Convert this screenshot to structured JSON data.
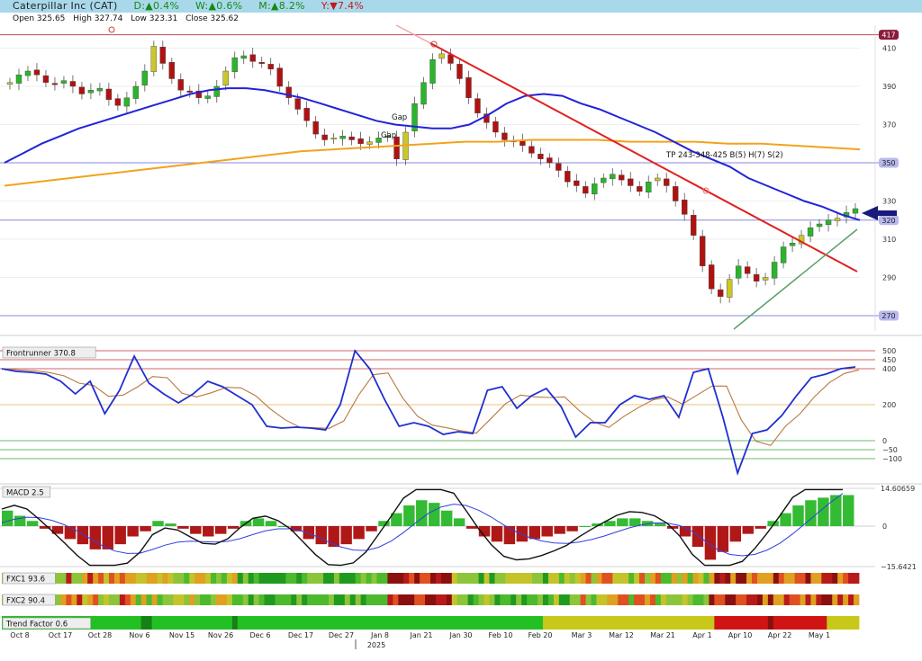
{
  "header": {
    "company": "Caterpillar Inc (CAT)",
    "day_change": "D:▲0.4%",
    "week_change": "W:▲0.6%",
    "month_change": "M:▲8.2%",
    "year_change": "Y:▼7.4%"
  },
  "ohlc": {
    "open": "Open 325.65",
    "high": "High 327.74",
    "low": "Low 323.31",
    "close": "Close 325.62"
  },
  "colors": {
    "header_bg": "#a9d8ea",
    "candle_up": "#2bb52b",
    "candle_down": "#b01212",
    "ma_fast": "#2323d8",
    "ma_slow": "#f2a31b",
    "trend_resistance": "#e02020",
    "trend_support": "#5aa06a"
  },
  "chart_data": [
    {
      "type": "candlestick",
      "ylim": [
        262,
        422
      ],
      "price_axis_labels": [
        410,
        390,
        370,
        350,
        330,
        320,
        310,
        290,
        270
      ],
      "highlighted_levels": [
        "417",
        "350",
        "320",
        "270"
      ],
      "level_lines": [
        417,
        350,
        320,
        270
      ],
      "x_ticks": [
        "Oct 8",
        "Oct 17",
        "Oct 28",
        "Nov 6",
        "Nov 15",
        "Nov 26",
        "Dec 6",
        "Dec 17",
        "Dec 27",
        "Jan 8",
        "Jan 21",
        "Jan 30",
        "Feb 10",
        "Feb 20",
        "Mar 3",
        "Mar 12",
        "Mar 21",
        "Apr 1",
        "Apr 10",
        "Apr 22",
        "May 1"
      ],
      "year_label": "2025",
      "closes": [
        392,
        396,
        398,
        396,
        392,
        391,
        393,
        390,
        386,
        388,
        389,
        383,
        380,
        384,
        390,
        398,
        411,
        402,
        394,
        388,
        387,
        384,
        385,
        390,
        398,
        405,
        406,
        403,
        402,
        399,
        390,
        384,
        378,
        372,
        365,
        362,
        363,
        364,
        362,
        360,
        361,
        363,
        364,
        352,
        366,
        381,
        392,
        404,
        407,
        402,
        394,
        384,
        376,
        371,
        366,
        362,
        361,
        359,
        355,
        352,
        350,
        346,
        340,
        338,
        334,
        339,
        342,
        344,
        341,
        338,
        335,
        340,
        342,
        338,
        330,
        323,
        312,
        296,
        284,
        280,
        289,
        296,
        292,
        288,
        290,
        298,
        306,
        308,
        312,
        316,
        318,
        320,
        321,
        324,
        326
      ],
      "moving_averages": [
        {
          "values": [
            350,
            355,
            360,
            364,
            368,
            371,
            374,
            377,
            380,
            383,
            386,
            388,
            389,
            389,
            388,
            386,
            384,
            381,
            378,
            375,
            372,
            370,
            369,
            368,
            368,
            370,
            375,
            381,
            385,
            386,
            385,
            381,
            378,
            374,
            370,
            366,
            361,
            356,
            352,
            348,
            342,
            338,
            334,
            330,
            327,
            323,
            320
          ]
        },
        {
          "values": [
            338,
            340,
            342,
            344,
            346,
            348,
            350,
            352,
            354,
            356,
            357,
            358,
            359,
            360,
            361,
            361,
            362,
            362,
            362,
            361,
            361,
            361,
            360,
            360,
            359,
            358,
            357
          ]
        }
      ],
      "annotations": [
        "Gap",
        "Gap",
        "TP 243-348-425 B(5) H(7) S(2)"
      ]
    },
    {
      "type": "line",
      "series": [
        {
          "name": "Frontrunner",
          "values": [
            400,
            385,
            380,
            370,
            330,
            260,
            330,
            150,
            280,
            470,
            320,
            260,
            210,
            260,
            330,
            300,
            250,
            200,
            80,
            70,
            75,
            70,
            60,
            200,
            500,
            400,
            230,
            80,
            100,
            80,
            35,
            50,
            40,
            280,
            300,
            180,
            250,
            290,
            190,
            20,
            100,
            100,
            200,
            250,
            230,
            250,
            130,
            380,
            400,
            130,
            -180,
            40,
            60,
            140,
            250,
            350,
            370,
            400,
            410
          ]
        }
      ],
      "last_value_label": "370.8",
      "ylim": [
        -210,
        560
      ],
      "levels": [
        500,
        450,
        400,
        200,
        0,
        -50,
        -100
      ],
      "level_labels": [
        "500",
        "450",
        "400",
        "200",
        "0",
        "−50",
        "−100"
      ]
    },
    {
      "type": "bar",
      "series": [
        {
          "name": "MACD",
          "values": [
            6,
            4,
            2,
            -1,
            -3,
            -5,
            -7,
            -9,
            -9,
            -7,
            -4,
            -2,
            2,
            1,
            -1,
            -3,
            -4,
            -3,
            -1,
            2,
            3,
            2,
            0,
            -2,
            -5,
            -7,
            -8,
            -7,
            -5,
            -2,
            2,
            5,
            8,
            10,
            9,
            6,
            3,
            -1,
            -4,
            -6,
            -7,
            -6,
            -5,
            -4,
            -3,
            -2,
            0,
            1,
            2,
            3,
            3,
            2,
            1,
            -1,
            -4,
            -8,
            -13,
            -10,
            -6,
            -3,
            -1,
            2,
            5,
            8,
            10,
            11,
            12,
            12
          ]
        }
      ],
      "label": "MACD 2.5",
      "y_labels": [
        "14.60659",
        "0",
        "−15.6421"
      ],
      "ylim": [
        -15.6421,
        14.60659
      ]
    },
    {
      "type": "heatmap",
      "rows": [
        {
          "label": "FXC1 93.6"
        },
        {
          "label": "FXC2 90.4"
        },
        {
          "label": "Trend Factor 0.6"
        }
      ]
    }
  ]
}
